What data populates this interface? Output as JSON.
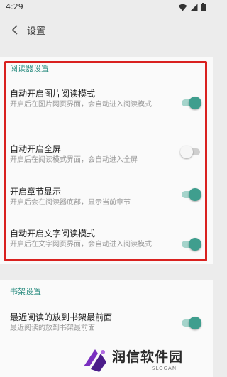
{
  "status_bar": {
    "time": "4:29"
  },
  "header": {
    "title": "设置"
  },
  "reader_section": {
    "title": "阅读器设置",
    "items": [
      {
        "title": "自动开启图片阅读模式",
        "summary": "开启后在图片网页界面，会自动进入阅读模式",
        "checked": true
      },
      {
        "title": "自动开启全屏",
        "summary": "开启后在阅读模式界面，会自动进入全屏",
        "checked": false
      },
      {
        "title": "开启章节显示",
        "summary": "开启后会在阅读器底部，显示当前章节",
        "checked": true
      },
      {
        "title": "自动开启文字阅读模式",
        "summary": "开启后在文字网页界面，会自动进入阅读模式",
        "checked": true
      }
    ]
  },
  "shelf_section": {
    "title": "书架设置",
    "items": [
      {
        "title": "最近阅读的放到书架最前面",
        "summary": "最近阅读的放到书架最前面",
        "checked": true
      }
    ]
  },
  "watermark": {
    "text": "润信软件园",
    "slogan": "SLOGAN"
  },
  "colors": {
    "accent": "#3f9e8e",
    "highlight": "#d9211f"
  },
  "icons": [
    "wifi-icon",
    "signal-icon",
    "battery-icon",
    "back-arrow-icon",
    "logo-icon"
  ]
}
